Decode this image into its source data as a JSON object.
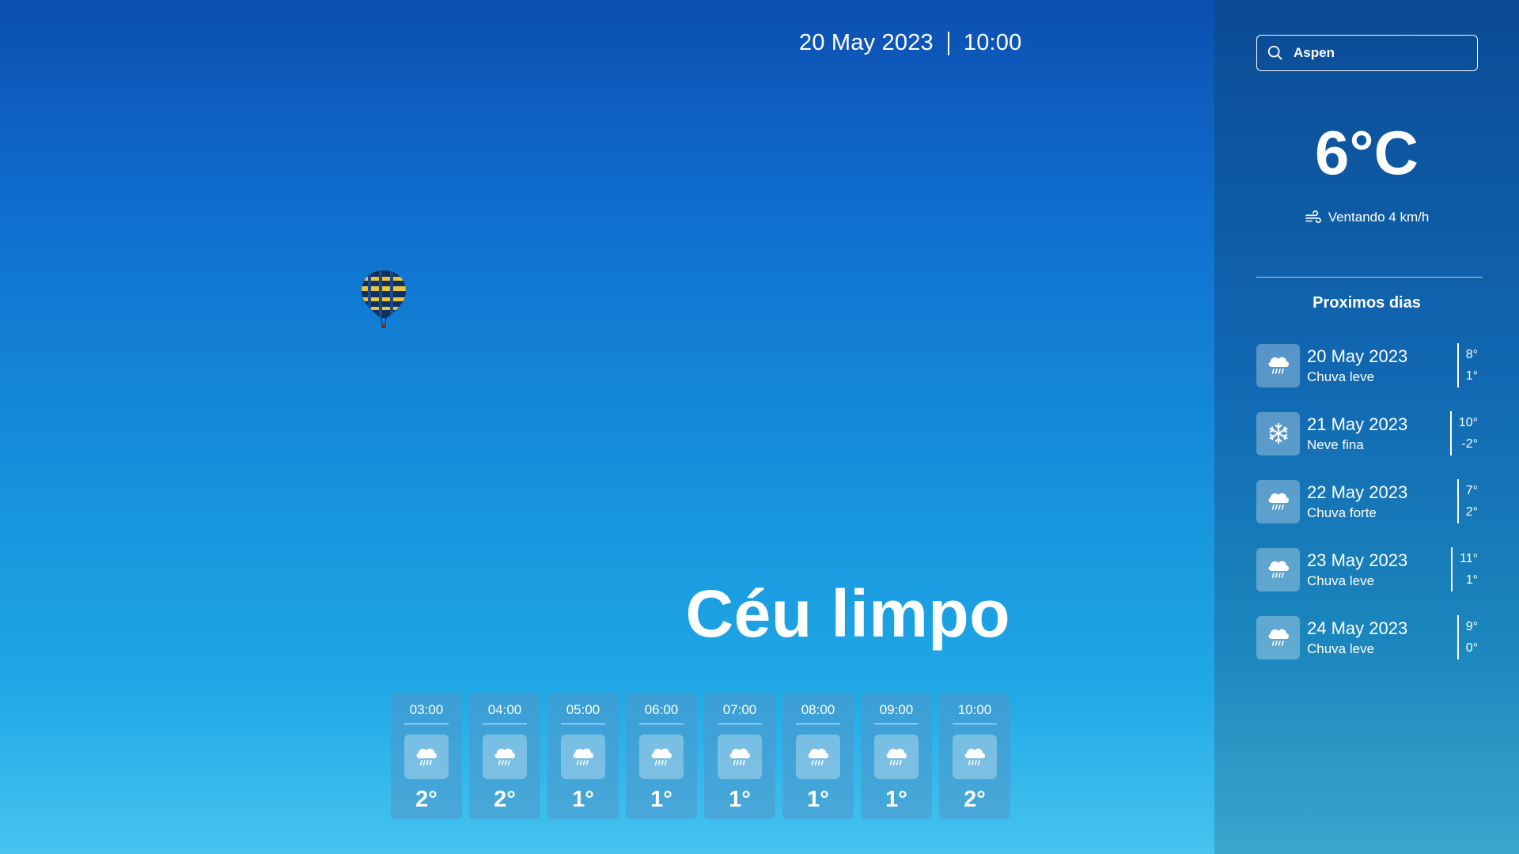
{
  "header": {
    "date": "20 May 2023",
    "time": "10:00"
  },
  "current": {
    "condition": "Céu limpo",
    "temperature": "6°C",
    "wind": "Ventando 4 km/h"
  },
  "search": {
    "value": "Aspen",
    "icon": "search-icon"
  },
  "hourly": [
    {
      "time": "03:00",
      "temp": "2°",
      "icon": "rain-cloud-icon"
    },
    {
      "time": "04:00",
      "temp": "2°",
      "icon": "rain-cloud-icon"
    },
    {
      "time": "05:00",
      "temp": "1°",
      "icon": "rain-cloud-icon"
    },
    {
      "time": "06:00",
      "temp": "1°",
      "icon": "rain-cloud-icon"
    },
    {
      "time": "07:00",
      "temp": "1°",
      "icon": "rain-cloud-icon"
    },
    {
      "time": "08:00",
      "temp": "1°",
      "icon": "rain-cloud-icon"
    },
    {
      "time": "09:00",
      "temp": "1°",
      "icon": "rain-cloud-icon"
    },
    {
      "time": "10:00",
      "temp": "2°",
      "icon": "rain-cloud-icon"
    }
  ],
  "forecast": {
    "title": "Proximos dias",
    "days": [
      {
        "date": "20 May 2023",
        "desc": "Chuva leve",
        "max": "8°",
        "min": "1°",
        "icon": "rain-cloud-icon"
      },
      {
        "date": "21 May 2023",
        "desc": "Neve fina",
        "max": "10°",
        "min": "-2°",
        "icon": "snowflake-icon"
      },
      {
        "date": "22 May 2023",
        "desc": "Chuva forte",
        "max": "7°",
        "min": "2°",
        "icon": "rain-cloud-icon"
      },
      {
        "date": "23 May 2023",
        "desc": "Chuva leve",
        "max": "11°",
        "min": "1°",
        "icon": "rain-cloud-icon"
      },
      {
        "date": "24 May 2023",
        "desc": "Chuva leve",
        "max": "9°",
        "min": "0°",
        "icon": "rain-cloud-icon"
      }
    ]
  }
}
